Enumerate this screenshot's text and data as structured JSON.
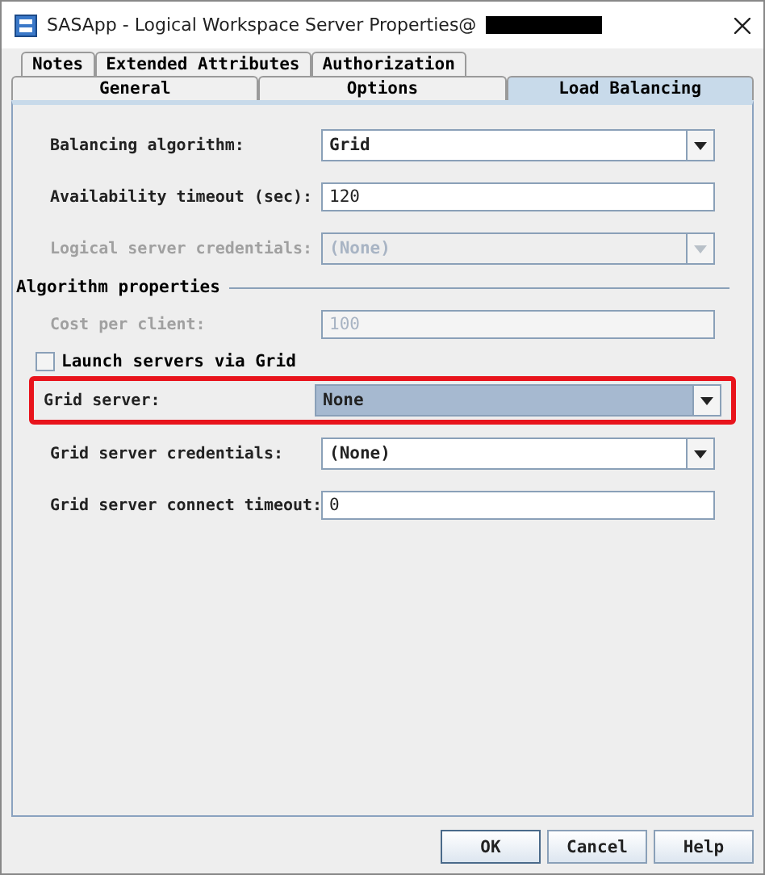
{
  "window": {
    "title": "SASApp - Logical Workspace Server Properties@",
    "title_redacted": true
  },
  "tab_rows": [
    [
      {
        "label": "Notes",
        "selected": false
      },
      {
        "label": "Extended Attributes",
        "selected": false
      },
      {
        "label": "Authorization",
        "selected": false
      }
    ],
    [
      {
        "label": "General",
        "selected": false
      },
      {
        "label": "Options",
        "selected": false
      },
      {
        "label": "Load Balancing",
        "selected": true
      }
    ]
  ],
  "top_fields": [
    {
      "label": "Balancing algorithm:",
      "kind": "dropdown",
      "value": "Grid",
      "disabled": false,
      "highlighted": false
    },
    {
      "label": "Availability timeout (sec):",
      "kind": "text",
      "value": "120",
      "disabled": false,
      "highlighted": false
    },
    {
      "label": "Logical server credentials:",
      "kind": "dropdown",
      "value": "(None)",
      "disabled": true,
      "highlighted": false
    }
  ],
  "algorithm_properties": {
    "heading": "Algorithm properties",
    "fields": [
      {
        "label": "Cost per client:",
        "kind": "text",
        "value": "100",
        "disabled": true,
        "highlighted": false
      }
    ],
    "checkbox": {
      "label": "Launch servers via Grid",
      "checked": false
    },
    "grid_fields": [
      {
        "label": "Grid server:",
        "kind": "dropdown",
        "value": "None",
        "disabled": false,
        "highlighted": true
      },
      {
        "label": "Grid server credentials:",
        "kind": "dropdown",
        "value": "(None)",
        "disabled": false,
        "highlighted": false
      },
      {
        "label": "Grid server connect timeout:",
        "kind": "text",
        "value": "0",
        "disabled": false,
        "highlighted": false
      }
    ]
  },
  "buttons": [
    {
      "label": "OK",
      "default": true
    },
    {
      "label": "Cancel",
      "default": false
    },
    {
      "label": "Help",
      "default": false
    }
  ]
}
